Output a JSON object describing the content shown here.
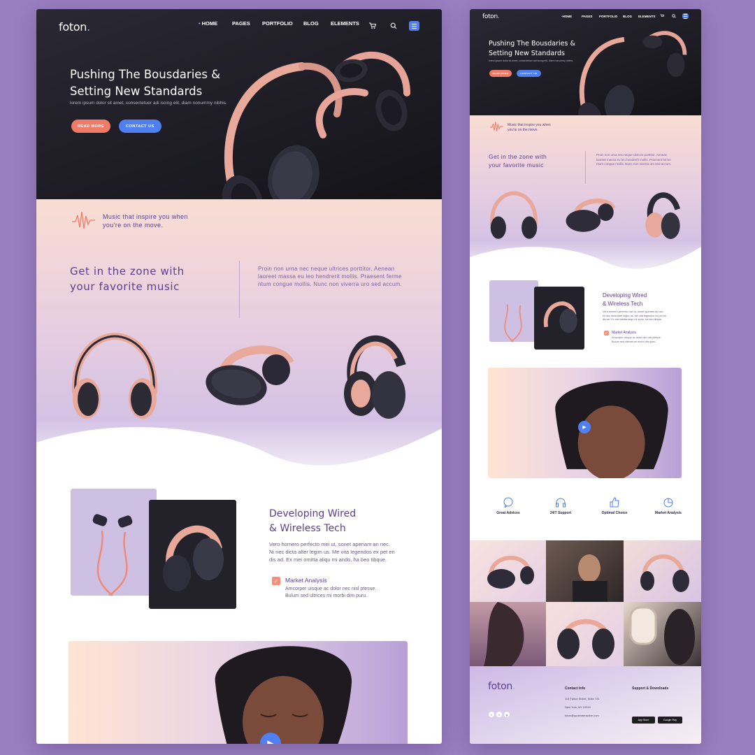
{
  "brand": {
    "name": "foton",
    "dot": "."
  },
  "nav": {
    "items": [
      "HOME",
      "PAGES",
      "PORTFOLIO",
      "BLOG",
      "ELEMENTS"
    ],
    "active": "HOME"
  },
  "hero": {
    "title_line1": "Pushing The Bousdaries &",
    "title_line2": "Setting New Standards",
    "subtitle": "lorem ipsum dolor sit amet, consectetuer adi iscing elit, diam nonummy nibhis.",
    "btn_primary": "READ MORE",
    "btn_secondary": "CONTACT US"
  },
  "tagline": {
    "line1": "Music that inspire you when",
    "line2": "you're on the move."
  },
  "zone": {
    "title_line1": "Get in the zone with",
    "title_line2": "your favorite music",
    "text_line1": "Proin non urna nec neque ultrices porttitor. Aenean",
    "text_line2": "laoreet massa eu leo hendrerit mollis. Praesent ferme",
    "text_line3": "ntum congue mollis. Nunc non viverra uro sed accum."
  },
  "tech": {
    "title_line1": "Developing Wired",
    "title_line2": "& Wireless Tech",
    "text_line1": "Vero homero perfecto mei ut, sonet aperiam an nec.",
    "text_line2": "Ni nec dicta alter legim us. Me vita legendos ex pet en",
    "text_line3": "dis ad. Ex mei omitta aliqu mi ando, ha beo tibque.",
    "feature_title": "Market Analysis",
    "feature_line1": "Amcorper uisque ac dolor nec nisl ptesue.",
    "feature_line2": "Bulum sed ultrices mi morbi dim puru."
  },
  "features": [
    {
      "title": "Great Advices",
      "icon": "chat-bubble-icon"
    },
    {
      "title": "24/7 Support",
      "icon": "headphones-icon"
    },
    {
      "title": "Optimal Choice",
      "icon": "thumbs-up-icon"
    },
    {
      "title": "Market Analysis",
      "icon": "pie-chart-icon"
    }
  ],
  "footer": {
    "contact_title": "Contact Info",
    "address1": "113 Fulton Street, Suite 721",
    "address2": "New York, NY 10010",
    "email": "foton@qodeinteractive.com",
    "support_title": "Support & Downloads",
    "store1": "App Store",
    "store2": "Google Play"
  },
  "colors": {
    "accent_blue": "#4f7ff0",
    "accent_orange": "#f07c67",
    "purple": "#5b3f8e",
    "background": "#9a7fc0"
  }
}
